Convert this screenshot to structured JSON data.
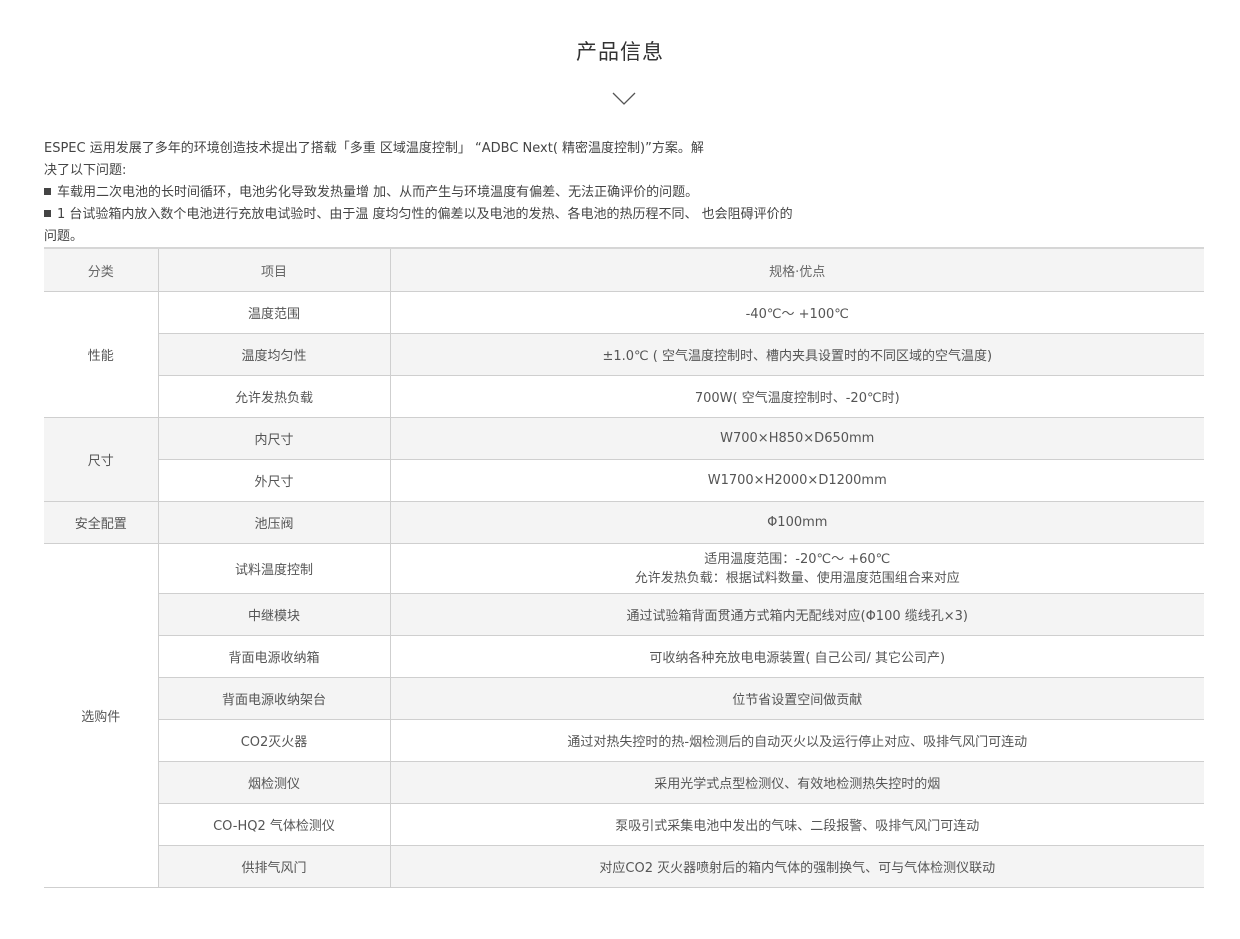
{
  "page": {
    "title": "产品信息",
    "chevron_icon": "chevron-down-icon"
  },
  "intro": {
    "line1": "ESPEC 运用发展了多年的环境创造技术提出了搭载「多重 区域温度控制」 “ADBC Next( 精密温度控制)”方案。解",
    "line2": "决了以下问题:",
    "bullet1": "车载用二次电池的长时间循环，电池劣化导致发热量增 加、从而产生与环境温度有偏差、无法正确评价的问题。",
    "bullet2": "1 台试验箱内放入数个电池进行充放电试验时、由于温 度均匀性的偏差以及电池的发热、各电池的热历程不同、 也会阻碍评价的问题。"
  },
  "table": {
    "headers": [
      "分类",
      "项目",
      "规格·优点"
    ],
    "categories": {
      "performance": "性能",
      "size": "尺寸",
      "safety": "安全配置",
      "options": "选购件"
    },
    "rows": [
      {
        "item": "温度范围",
        "spec": "-40℃～ +100℃"
      },
      {
        "item": "温度均匀性",
        "spec": "±1.0℃ ( 空气温度控制时、槽内夹具设置时的不同区域的空气温度)"
      },
      {
        "item": "允许发热负载",
        "spec": "700W( 空气温度控制时、-20℃时)"
      },
      {
        "item": "内尺寸",
        "spec": "W700×H850×D650mm"
      },
      {
        "item": "外尺寸",
        "spec": "W1700×H2000×D1200mm"
      },
      {
        "item": "池压阀",
        "spec": "Φ100mm"
      },
      {
        "item": "试料温度控制",
        "spec": "适用温度范围：-20℃～ +60℃",
        "spec2": "允许发热负载：根据试料数量、使用温度范围组合来对应"
      },
      {
        "item": "中继模块",
        "spec": "通过试验箱背面贯通方式箱内无配线对应(Φ100 缆线孔×3)"
      },
      {
        "item": "背面电源收纳箱",
        "spec": "可收纳各种充放电电源装置( 自己公司/ 其它公司产)"
      },
      {
        "item": "背面电源收纳架台",
        "spec": "位节省设置空间做贡献"
      },
      {
        "item": "CO2灭火器",
        "spec": "通过对热失控时的热-烟检测后的自动灭火以及运行停止对应、吸排气风门可连动"
      },
      {
        "item": "烟检测仪",
        "spec": "采用光学式点型检测仪、有效地检测热失控时的烟"
      },
      {
        "item": "CO-HQ2 气体检测仪",
        "spec": "泵吸引式采集电池中发出的气味、二段报警、吸排气风门可连动"
      },
      {
        "item": "供排气风门",
        "spec": "对应CO2 灭火器喷射后的箱内气体的强制换气、可与气体检测仪联动"
      }
    ]
  }
}
